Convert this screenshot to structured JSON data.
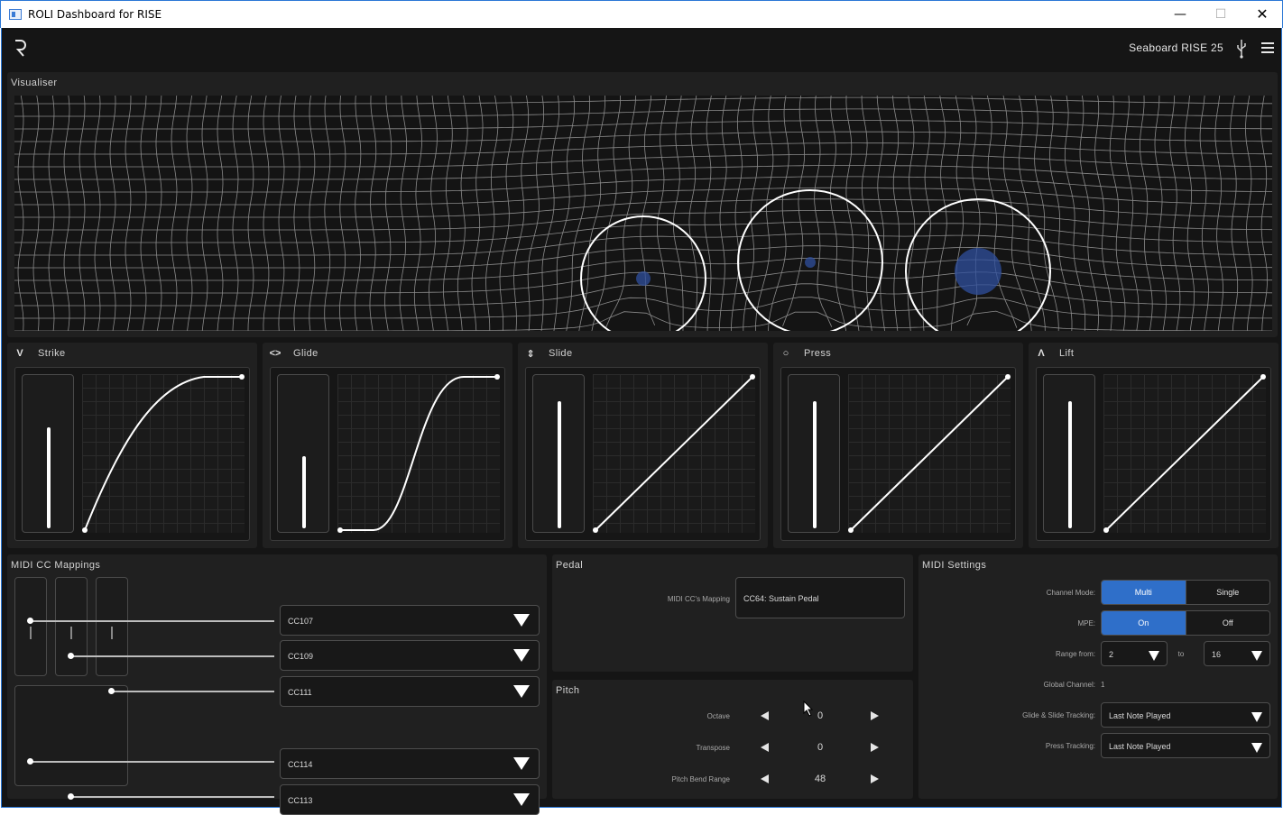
{
  "window": {
    "title": "ROLI Dashboard for RISE",
    "min": "—",
    "max": "☐",
    "close": "✕"
  },
  "header": {
    "device_name": "Seaboard RISE 25"
  },
  "visualiser": {
    "title": "Visualiser"
  },
  "dimensions": [
    {
      "label": "Strike",
      "icon": "V",
      "level": 0.7,
      "curve": "log"
    },
    {
      "label": "Glide",
      "icon": "<>",
      "level": 0.5,
      "curve": "s"
    },
    {
      "label": "Slide",
      "icon": "⇕",
      "level": 0.88,
      "curve": "linear"
    },
    {
      "label": "Press",
      "icon": "○",
      "level": 0.88,
      "curve": "linear"
    },
    {
      "label": "Lift",
      "icon": "Λ",
      "level": 0.88,
      "curve": "linear"
    }
  ],
  "midi_cc": {
    "title": "MIDI CC Mappings",
    "mappings": [
      {
        "value": "CC107"
      },
      {
        "value": "CC109"
      },
      {
        "value": "CC111"
      },
      {
        "value": "CC114"
      },
      {
        "value": "CC113"
      }
    ]
  },
  "pedal": {
    "title": "Pedal",
    "mapping_label": "MIDI CC's Mapping",
    "mapping_value": "CC64: Sustain Pedal"
  },
  "pitch": {
    "title": "Pitch",
    "rows": [
      {
        "label": "Octave",
        "value": "0"
      },
      {
        "label": "Transpose",
        "value": "0"
      },
      {
        "label": "Pitch Bend Range",
        "value": "48"
      }
    ]
  },
  "midi_settings": {
    "title": "MIDI Settings",
    "channel_mode_label": "Channel Mode:",
    "channel_mode_options": [
      "Multi",
      "Single"
    ],
    "mpe_label": "MPE:",
    "mpe_options": [
      "On",
      "Off"
    ],
    "range_from_label": "Range from:",
    "range_from_value": "2",
    "range_to_label": "to",
    "range_to_value": "16",
    "global_channel_label": "Global Channel:",
    "global_channel_value": "1",
    "glide_slide_label": "Glide & Slide Tracking:",
    "glide_slide_value": "Last Note Played",
    "press_tracking_label": "Press Tracking:",
    "press_tracking_value": "Last Note Played"
  },
  "colors": {
    "accent": "#2f6fc9",
    "background": "#151515",
    "panel": "#202020"
  }
}
